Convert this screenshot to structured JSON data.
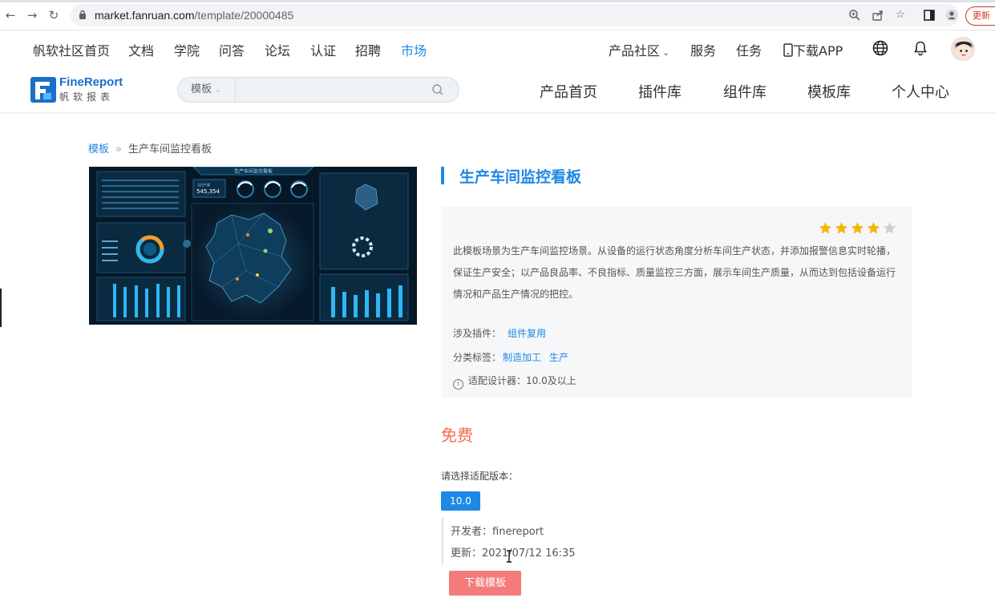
{
  "browser": {
    "back_icon": "arrow-left-icon",
    "forward_icon": "arrow-right-icon",
    "reload_icon": "reload-icon",
    "url_host": "market.fanruan.com",
    "url_path": "/template/20000485",
    "update_label": "更新"
  },
  "topnav": {
    "items": [
      "帆软社区首页",
      "文档",
      "学院",
      "问答",
      "论坛",
      "认证",
      "招聘",
      "市场"
    ],
    "active": "市场",
    "right_items": [
      "产品社区",
      "服务",
      "任务",
      "下载APP"
    ]
  },
  "secnav": {
    "logo_name": "FineReport",
    "logo_cn": "帆软报表",
    "search_scope": "模板",
    "search_placeholder": "",
    "items": [
      "产品首页",
      "插件库",
      "组件库",
      "模板库",
      "个人中心"
    ]
  },
  "breadcrumb": {
    "root": "模板",
    "separator": "»",
    "current": "生产车间监控看板"
  },
  "template": {
    "title": "生产车间监控看板",
    "rating": 4,
    "rating_max": 5,
    "description": "此模板场景为生产车间监控场景。从设备的运行状态角度分析车间生产状态，并添加报警信息实时轮播，保证生产安全；以产品良品率、不良指标、质量监控三方面，展示车间生产质量，从而达到包括设备运行情况和产品生产情况的把控。",
    "plugins_label": "涉及插件：",
    "plugins": [
      "组件复用"
    ],
    "tags_label": "分类标签：",
    "tags": [
      "制造加工",
      "生产"
    ],
    "designer_label": "适配设计器：",
    "designer_value": "10.0及以上",
    "price": "免费",
    "version_prompt": "请选择适配版本：",
    "version": "10.0",
    "developer_label": "开发者：",
    "developer": "finereport",
    "updated_label": "更新：",
    "updated": "2021/07/12 16:35",
    "download_label": "下载模板"
  },
  "colors": {
    "accent": "#1e88e5",
    "price": "#f06b4f",
    "download": "#f47b7b",
    "star": "#f5b800"
  }
}
